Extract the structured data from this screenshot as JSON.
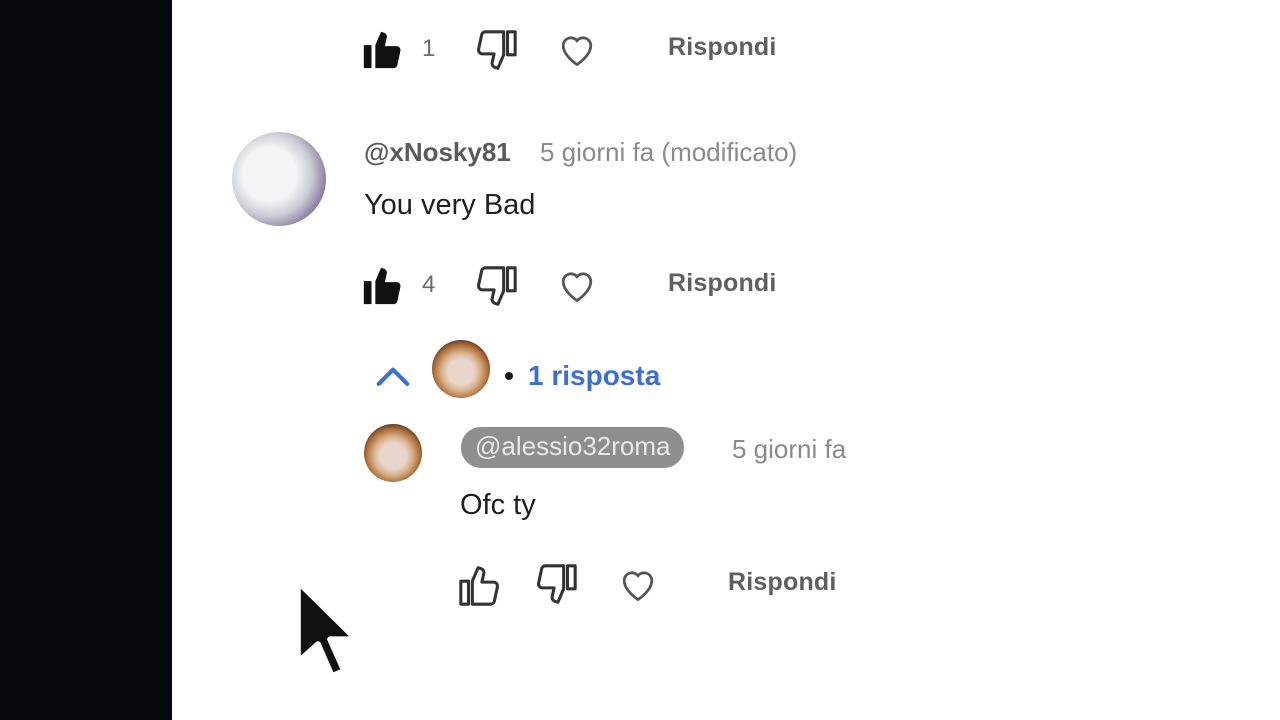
{
  "first_comment_actions": {
    "like_count": "1",
    "reply_label": "Rispondi"
  },
  "comment": {
    "handle": "@xNosky81",
    "meta": "5 giorni fa (modificato)",
    "text": "You very Bad",
    "like_count": "4",
    "reply_label": "Rispondi"
  },
  "replies_toggle": {
    "label": "1 risposta"
  },
  "reply": {
    "handle": "@alessio32roma",
    "meta": "5 giorni fa",
    "text": "Ofc ty",
    "reply_label": "Rispondi"
  },
  "colors": {
    "link_blue": "#3b6fd6",
    "left_panel": "#05090d"
  },
  "icons": [
    "thumb-up-filled-icon",
    "thumb-down-icon",
    "heart-icon",
    "chevron-up-icon",
    "mouse-cursor-icon"
  ]
}
